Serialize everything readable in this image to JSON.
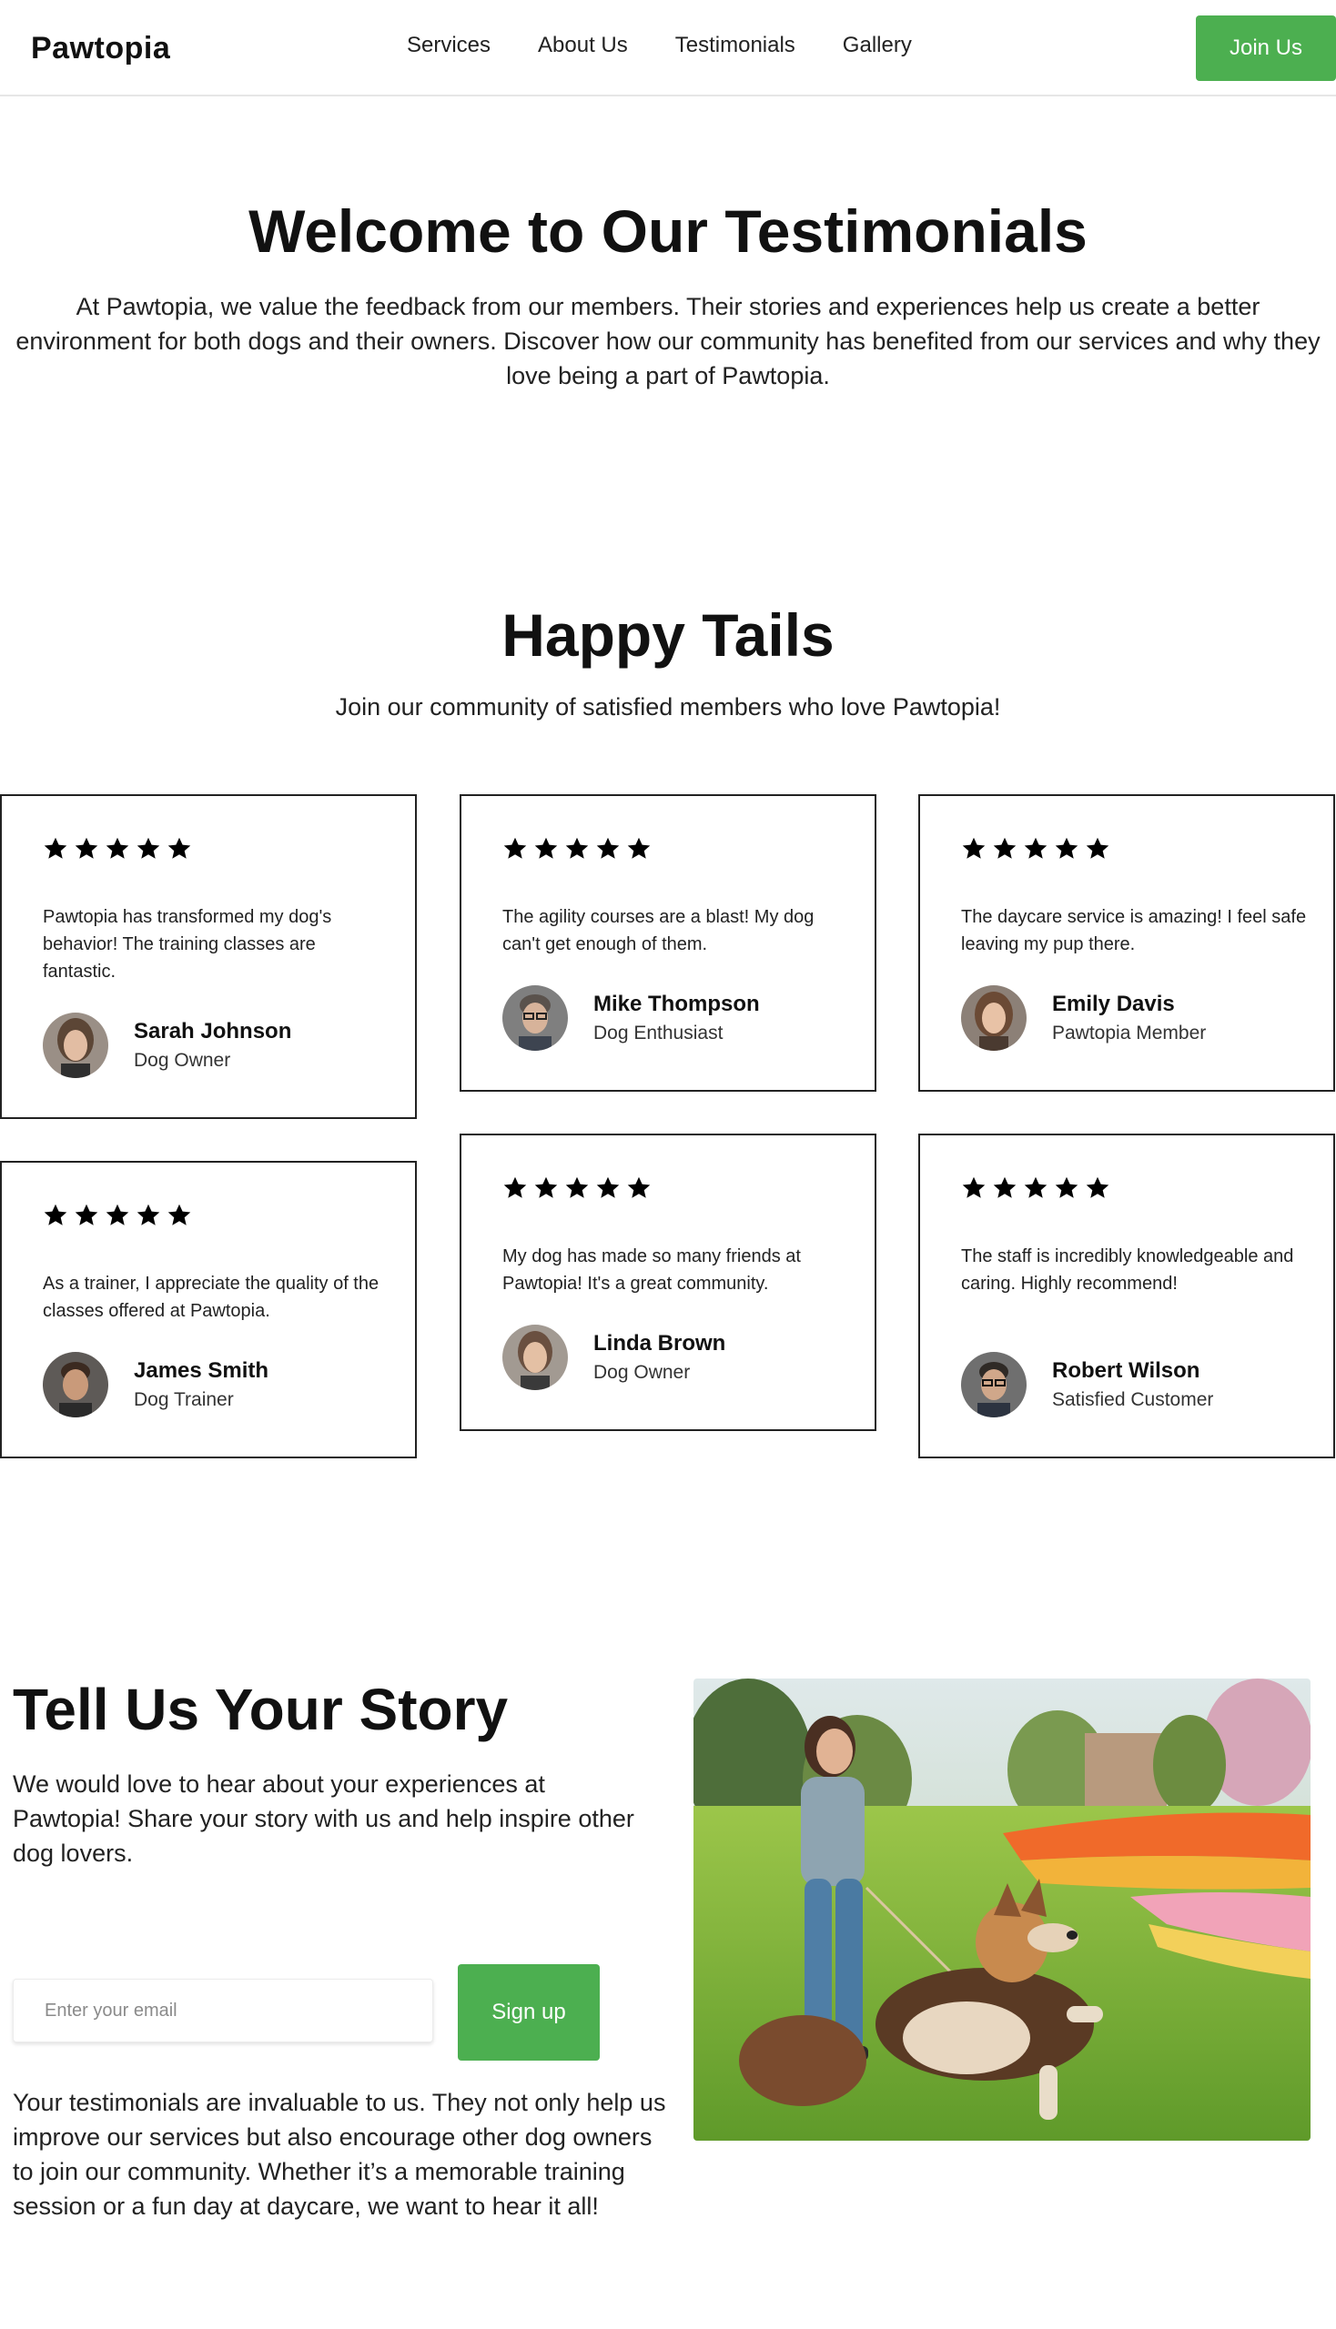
{
  "header": {
    "logo": "Pawtopia",
    "nav": [
      "Services",
      "About Us",
      "Testimonials",
      "Gallery"
    ],
    "join_label": "Join Us"
  },
  "welcome": {
    "title": "Welcome to Our Testimonials",
    "text": "At Pawtopia, we value the feedback from our members. Their stories and experiences help us create a better environment for both dogs and their owners. Discover how our community has benefited from our services and why they love being a part of Pawtopia."
  },
  "tails": {
    "title": "Happy Tails",
    "subtitle": "Join our community of satisfied members who love Pawtopia!",
    "testimonials": [
      {
        "rating": 5,
        "quote": "Pawtopia has transformed my dog's behavior! The training classes are fantastic.",
        "name": "Sarah Johnson",
        "role": "Dog Owner"
      },
      {
        "rating": 5,
        "quote": "The agility courses are a blast! My dog can't get enough of them.",
        "name": "Mike Thompson",
        "role": "Dog Enthusiast"
      },
      {
        "rating": 5,
        "quote": "The daycare service is amazing! I feel safe leaving my pup there.",
        "name": "Emily Davis",
        "role": "Pawtopia Member"
      },
      {
        "rating": 5,
        "quote": "As a trainer, I appreciate the quality of the classes offered at Pawtopia.",
        "name": "James Smith",
        "role": "Dog Trainer"
      },
      {
        "rating": 5,
        "quote": "My dog has made so many friends at Pawtopia! It's a great community.",
        "name": "Linda Brown",
        "role": "Dog Owner"
      },
      {
        "rating": 5,
        "quote": "The staff is incredibly knowledgeable and caring. Highly recommend!",
        "name": "Robert Wilson",
        "role": "Satisfied Customer"
      }
    ]
  },
  "story": {
    "title": "Tell Us Your Story",
    "text": "We would love to hear about your experiences at Pawtopia! Share your story with us and help inspire other dog lovers.",
    "email_placeholder": "Enter your email",
    "signup_label": "Sign up",
    "text2": "Your testimonials are invaluable to us. They not only help us improve our services but also encourage other dog owners to join our community. Whether it’s a memorable training session or a fun day at daycare, we want to hear it all!"
  },
  "colors": {
    "accent": "#4caf50",
    "text": "#111111",
    "card_border": "#222222"
  }
}
